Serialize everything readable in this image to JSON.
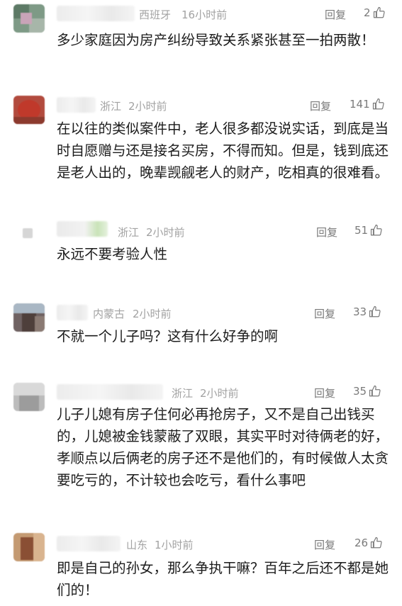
{
  "comments": [
    {
      "location": "西班牙",
      "time": "16小时前",
      "reply_label": "回复",
      "likes": "2",
      "text": "多少家庭因为房产纠纷导致关系紧张甚至一拍两散！",
      "avatar_color": "#6f8f78"
    },
    {
      "location": "浙江",
      "time": "2小时前",
      "reply_label": "回复",
      "likes": "141",
      "text": "在以往的类似案件中，老人很多都没说实话，到底是当时自愿赠与还是接名买房，不得而知。但是，钱到底还是老人出的，晚辈觊觎老人的财产，吃相真的很难看。",
      "avatar_color": "#b24b3e"
    },
    {
      "location": "浙江",
      "time": "2小时前",
      "reply_label": "回复",
      "likes": "51",
      "text": "永远不要考验人性",
      "avatar_color": "#d8d8d8"
    },
    {
      "location": "内蒙古",
      "time": "2小时前",
      "reply_label": "回复",
      "likes": "33",
      "text": "不就一个儿子吗？这有什么好争的啊",
      "avatar_color": "#7c6a66"
    },
    {
      "location": "浙江",
      "time": "2小时前",
      "reply_label": "回复",
      "likes": "35",
      "text": "儿子儿媳有房子住何必再抢房子，又不是自己出钱买的，儿媳被金钱蒙蔽了双眼，其实平时对待俩老的好，孝顺点以后俩老的房子还不是他们的，有时候做人太贪要吃亏的，不计较也会吃亏，看什么事吧",
      "avatar_color": "#bdbdbd"
    },
    {
      "location": "山东",
      "time": "1小时前",
      "reply_label": "回复",
      "likes": "26",
      "text": "即是自己的孙女，那么争执干嘛？百年之后还不都是她们的！",
      "avatar_color": "#b07a56"
    }
  ]
}
